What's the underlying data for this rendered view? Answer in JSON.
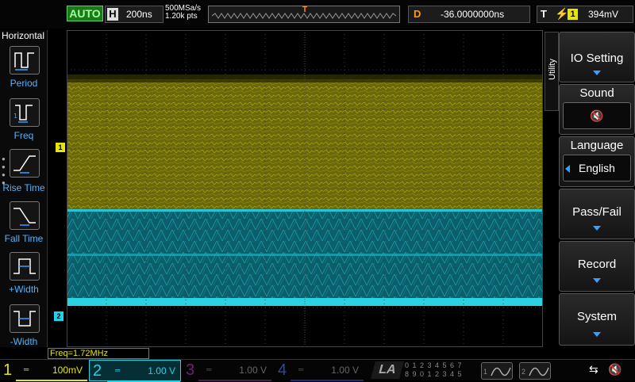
{
  "topbar": {
    "run_state": "AUTO",
    "horizontal_label": "H",
    "timebase": "200ns",
    "sample_rate": "500MSa/s",
    "memory_depth": "1.20k pts",
    "trigger_marker": "T",
    "delay_label": "D",
    "delay_value": "-36.0000000ns",
    "trigger_label": "T",
    "trigger_edge": "⚡",
    "trigger_source": "1",
    "trigger_level": "394mV"
  },
  "left_panel": {
    "title": "Horizontal",
    "items": [
      {
        "label": "Period"
      },
      {
        "label": "Freq"
      },
      {
        "label": "Rise Time"
      },
      {
        "label": "Fall Time"
      },
      {
        "label": "+Width"
      },
      {
        "label": "-Width"
      }
    ]
  },
  "scope": {
    "ch1_marker": "1",
    "ch2_marker": "2",
    "trigger_pos_marker": "T",
    "ch1_color": "#b5b20f",
    "ch2_color": "#1fb6c4"
  },
  "right_menu": {
    "tab": "Utility",
    "io_setting": "IO Setting",
    "sound": "Sound",
    "sound_icon": "speaker-muted-icon",
    "language": "Language",
    "language_value": "English",
    "pass_fail": "Pass/Fail",
    "record": "Record",
    "system": "System"
  },
  "measurement": {
    "freq": "Freq=1.72MHz"
  },
  "bottombar": {
    "channels": [
      {
        "num": "1",
        "scale": "100mV",
        "color": "#e6e600"
      },
      {
        "num": "2",
        "scale": "1.00 V",
        "color": "#21d3e6"
      },
      {
        "num": "3",
        "scale": "1.00 V",
        "color": "#b01ec8"
      },
      {
        "num": "4",
        "scale": "1.00 V",
        "color": "#2a5ae6"
      }
    ],
    "la_label": "LA",
    "la_row1": "0 1 2 3  4 5 6 7",
    "la_row2": "8 9 0 1  2 3 4 5",
    "d1": "1",
    "d2": "2"
  }
}
